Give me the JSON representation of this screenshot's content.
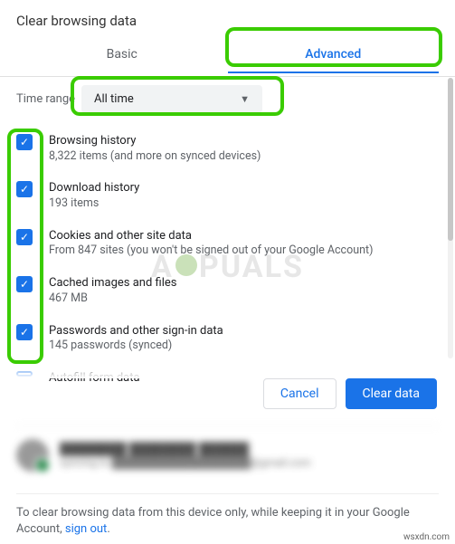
{
  "header": {
    "title": "Clear browsing data",
    "tabs": {
      "basic": "Basic",
      "advanced": "Advanced",
      "active": "advanced"
    }
  },
  "time": {
    "label": "Time range",
    "value": "All time"
  },
  "items": [
    {
      "title": "Browsing history",
      "sub": "8,322 items (and more on synced devices)",
      "checked": true
    },
    {
      "title": "Download history",
      "sub": "193 items",
      "checked": true
    },
    {
      "title": "Cookies and other site data",
      "sub": "From 847 sites (you won't be signed out of your Google Account)",
      "checked": true
    },
    {
      "title": "Cached images and files",
      "sub": "467 MB",
      "checked": true
    },
    {
      "title": "Passwords and other sign-in data",
      "sub": "145 passwords (synced)",
      "checked": true
    },
    {
      "title": "Autofill form data",
      "sub": "",
      "checked": true
    }
  ],
  "buttons": {
    "cancel": "Cancel",
    "clear": "Clear data"
  },
  "account": {
    "name": "████████ ████████ ██████",
    "email": "syncing to ██████████████████@gmail.com"
  },
  "footer": {
    "text_a": "To clear browsing data from this device only, while keeping it in your Google Account, ",
    "link": "sign out",
    "text_b": "."
  },
  "watermark": {
    "pre": "A",
    "post": "PUALS"
  },
  "attribution": "wsxdn.com"
}
